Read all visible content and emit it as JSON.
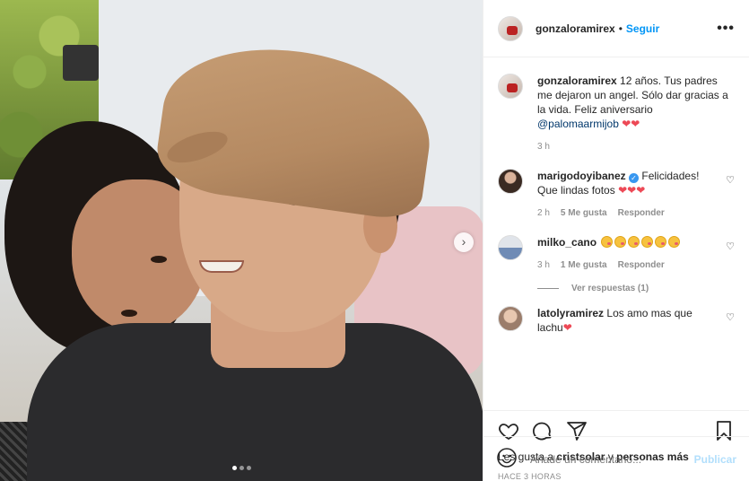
{
  "header": {
    "username": "gonzaloramirex",
    "separator": "•",
    "follow_label": "Seguir",
    "more_icon": "more-horizontal-icon"
  },
  "carousel": {
    "current_index": 1,
    "total_images": 3
  },
  "caption": {
    "username": "gonzaloramirex",
    "text": "12 años. Tus padres me dejaron un angel. Sólo dar gracias a la vida. Feliz aniversario",
    "mention": "@palomaarmijob",
    "time": "3 h"
  },
  "comments": [
    {
      "username": "marigodoyibanez",
      "verified": true,
      "text": "Felicidades! Que lindas fotos",
      "time": "2 h",
      "likes": "5 Me gusta",
      "reply": "Responder"
    },
    {
      "username": "milko_cano",
      "verified": false,
      "text": "",
      "time": "3 h",
      "likes": "1 Me gusta",
      "reply": "Responder",
      "view_replies": "Ver respuestas (1)"
    },
    {
      "username": "latolyramirez",
      "verified": false,
      "text": "Los amo mas que lachu"
    }
  ],
  "actions": {
    "likes_prefix": "Les gusta a",
    "likes_user": "cristsolar",
    "likes_joiner": "y",
    "likes_others": "personas más",
    "timestamp": "HACE 3 HORAS"
  },
  "add_comment": {
    "placeholder": "Añade un comentario...",
    "post_label": "Publicar"
  },
  "colors": {
    "link_blue": "#0095f6",
    "heart_red": "#ed4956",
    "muted": "#8e8e8e",
    "post_disabled": "#b2dffc"
  }
}
